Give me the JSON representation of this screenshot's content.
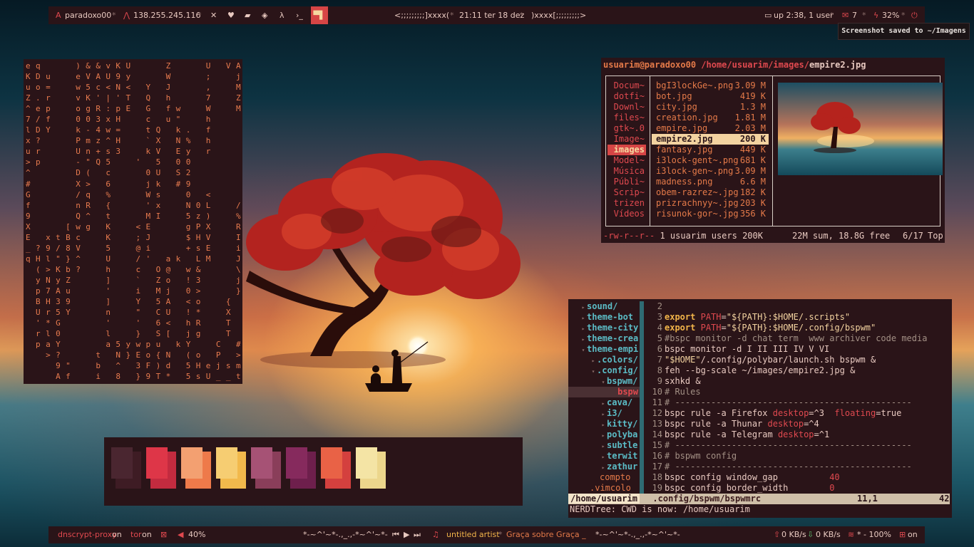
{
  "topbar": {
    "hostname": "paradoxo00",
    "ip": "138.255.245.116",
    "separator": "*",
    "workspace_icons": [
      "x-icon",
      "heart-icon",
      "folder-icon",
      "fox-icon",
      "lambda-icon",
      "terminal-icon"
    ],
    "active_workspace_glyph": "▀▌",
    "deco_left": "<;;;;;;;;;]xxxx(",
    "clock": "21:11 ter 18 dez",
    "deco_right": ")xxxx[;;;;;;;;;>",
    "uptime": "up 2:38, 1 user",
    "mail_count": "7",
    "battery": "32%"
  },
  "notification": "Screenshot saved to ~/Imagens",
  "matrix_lines": [
    "e q       ) & & v K U       Z       U   V A a",
    "K D u     e V A U 9 y       W       ;     j >",
    "u o =     w 5 c < N <   Y   J       ,     M",
    "Z . r     v K ' | ' T   Q   h       7     Z",
    "^ e p     o g R : p E   G   f w     W     M",
    "7 / f     0 0 3 x H     c   u \"     h",
    "l D Y     k - 4 w =     t Q   k .   f",
    "x ?       P m z ^ H     ` X   N %   h",
    "u r       U n + s 3     k V   E y   r",
    "> p       - \" Q 5     '   5   0 0",
    "^         D (   c       0 U   S 2",
    "#         X >   6       j k   # 9",
    "G         / q   %       W s     0   <       y",
    "f         n R   {       ' x     N 0 L     / #",
    "9         Q ^   t       M I     5 z )     % |",
    "X       [ w g   K     < E       g P X     R u %",
    "E   x t B c     K     ; J       $ H V     I l -",
    "_ ? 9 / 8 V     5     @ i       + s E     i * ;",
    "q H l \" } ^     U     / '   a k   L M     J o t",
    "  ( > K b ?     h     c   O @   w &       \\ 0 X",
    "  y N y Z       ]     `   Z o   ! 3       j w ,",
    "  p 7 A u       '     i   M j   0 >       } w .",
    "  B H 3 9       ]     Y   5 A   < o     {   t &",
    "  U r 5 Y       n     \"   C U   ! *     X   <",
    "  ' * G         '     '   6 <   h R     T   (",
    "  r l 0         l     }   S [   j g     T   (",
    "  p a Y         a 5 y w p u   k Y     C   #",
    "    > ?       t   N } E o { N   ( o   P   >",
    "      9 \"     b   ^   3 F ) d   5 H e j s m",
    "      A f     i   8   } 9 T *   5 s U _ _ t"
  ],
  "palette": {
    "colors": [
      "#3e1c24",
      "#c32b3f",
      "#ee7a4a",
      "#f2b94c",
      "#8a3e5a",
      "#6e1f4c",
      "#d4403e",
      "#ecd68c"
    ],
    "shades": [
      "#4a2630",
      "#de3648",
      "#f3a071",
      "#f6cd72",
      "#a65275",
      "#862a5d",
      "#e96246",
      "#f4e4a5"
    ]
  },
  "ranger": {
    "user_host": "usuarim@paradoxo00",
    "dir_path": "/home/usuarim/images/",
    "file_name": "empire2.jpg",
    "parent_dirs": [
      "Docum~",
      "dotfi~",
      "Downl~",
      "files~",
      "gtk~.0",
      "Image~",
      "images",
      "Model~",
      "Música",
      "Públi~",
      "Scrip~",
      "trizen",
      "Vídeos"
    ],
    "files": [
      {
        "name": "bgI3lockGe~.png",
        "size": "3.09 M"
      },
      {
        "name": "bot.jpg",
        "size": "419 K"
      },
      {
        "name": "city.jpg",
        "size": "1.3 M"
      },
      {
        "name": "creation.jpg",
        "size": "1.81 M"
      },
      {
        "name": "empire.jpg",
        "size": "2.03 M"
      },
      {
        "name": "empire2.jpg",
        "size": "200 K"
      },
      {
        "name": "fantasy.jpg",
        "size": "449 K"
      },
      {
        "name": "i3lock-gent~.png",
        "size": "681 K"
      },
      {
        "name": "i3lock-gen~.png",
        "size": "3.09 M"
      },
      {
        "name": "madness.png",
        "size": "6.6 M"
      },
      {
        "name": "obem-razrez~.jpg",
        "size": "182 K"
      },
      {
        "name": "prizrachnyy~.jpg",
        "size": "203 K"
      },
      {
        "name": "risunok-gor~.jpg",
        "size": "356 K"
      }
    ],
    "perms": "-rw-r--r--",
    "meta": "1 usuarim users 200K",
    "summary": "22M sum, 18.8G free",
    "position": "6/17",
    "scroll": "Top"
  },
  "vim": {
    "tree": [
      {
        "name": "sound/",
        "indent": 1,
        "arrow": "▸",
        "type": "dir"
      },
      {
        "name": "theme-bot",
        "indent": 1,
        "arrow": "▸",
        "type": "dir"
      },
      {
        "name": "theme-city",
        "indent": 1,
        "arrow": "▸",
        "type": "dir"
      },
      {
        "name": "theme-crea",
        "indent": 1,
        "arrow": "▸",
        "type": "dir"
      },
      {
        "name": "theme-empi",
        "indent": 1,
        "arrow": "▾",
        "type": "dir"
      },
      {
        "name": ".colors/",
        "indent": 2,
        "arrow": "▸",
        "type": "dir"
      },
      {
        "name": ".config/",
        "indent": 2,
        "arrow": "▾",
        "type": "dir"
      },
      {
        "name": "bspwm/",
        "indent": 3,
        "arrow": "▾",
        "type": "dir"
      },
      {
        "name": "bspw",
        "indent": 4,
        "arrow": "",
        "type": "cur"
      },
      {
        "name": "cava/",
        "indent": 3,
        "arrow": "▸",
        "type": "dir"
      },
      {
        "name": "i3/",
        "indent": 3,
        "arrow": "▸",
        "type": "dir"
      },
      {
        "name": "kitty/",
        "indent": 3,
        "arrow": "▸",
        "type": "dir"
      },
      {
        "name": "polyba",
        "indent": 3,
        "arrow": "▸",
        "type": "dir"
      },
      {
        "name": "subtle",
        "indent": 3,
        "arrow": "▸",
        "type": "dir"
      },
      {
        "name": "terwit",
        "indent": 3,
        "arrow": "▸",
        "type": "dir"
      },
      {
        "name": "zathur",
        "indent": 3,
        "arrow": "▸",
        "type": "dir"
      },
      {
        "name": "compto",
        "indent": 3,
        "arrow": "",
        "type": "file"
      },
      {
        "name": ".vimcolo",
        "indent": 2,
        "arrow": "",
        "type": "file"
      }
    ],
    "code": [
      {
        "n": "2",
        "t": []
      },
      {
        "n": "3",
        "t": [
          [
            "kw",
            "export"
          ],
          [
            "pu",
            " "
          ],
          [
            "sv",
            "PATH"
          ],
          [
            "pu",
            "="
          ],
          [
            "st",
            "\"${PATH}:$HOME/.scripts\""
          ]
        ]
      },
      {
        "n": "4",
        "t": [
          [
            "kw",
            "export"
          ],
          [
            "pu",
            " "
          ],
          [
            "sv",
            "PATH"
          ],
          [
            "pu",
            "="
          ],
          [
            "st",
            "\"${PATH}:$HOME/.config/bspwm\""
          ]
        ]
      },
      {
        "n": "5",
        "t": [
          [
            "cm",
            "#bspc monitor -d chat term  www archiver code media"
          ]
        ]
      },
      {
        "n": "6",
        "t": [
          [
            "pu",
            "bspc monitor -d I II III IV V VI"
          ]
        ]
      },
      {
        "n": "7",
        "t": [
          [
            "st",
            "\"$HOME\""
          ],
          [
            "pu",
            "/.config/polybar/launch.sh bspwm &"
          ]
        ]
      },
      {
        "n": "8",
        "t": [
          [
            "pu",
            "feh --bg-scale ~/images/empire2.jpg &"
          ]
        ]
      },
      {
        "n": "9",
        "t": [
          [
            "pu",
            "sxhkd &"
          ]
        ]
      },
      {
        "n": "10",
        "t": [
          [
            "cm",
            "# Rules"
          ]
        ]
      },
      {
        "n": "11",
        "t": [
          [
            "cm",
            "# ----------------------------------------------"
          ]
        ]
      },
      {
        "n": "12",
        "t": [
          [
            "pu",
            "bspc rule -a Firefox "
          ],
          [
            "sv",
            "desktop"
          ],
          [
            "pu",
            "=^3  "
          ],
          [
            "sv",
            "floating"
          ],
          [
            "pu",
            "=true"
          ]
        ]
      },
      {
        "n": "13",
        "t": [
          [
            "pu",
            "bspc rule -a Thunar "
          ],
          [
            "sv",
            "desktop"
          ],
          [
            "pu",
            "=^4"
          ]
        ]
      },
      {
        "n": "14",
        "t": [
          [
            "pu",
            "bspc rule -a Telegram "
          ],
          [
            "sv",
            "desktop"
          ],
          [
            "pu",
            "=^1"
          ]
        ]
      },
      {
        "n": "15",
        "t": [
          [
            "cm",
            "# ----------------------------------------------"
          ]
        ]
      },
      {
        "n": "16",
        "t": [
          [
            "cm",
            "# bspwm config"
          ]
        ]
      },
      {
        "n": "17",
        "t": [
          [
            "cm",
            "# ----------------------------------------------"
          ]
        ]
      },
      {
        "n": "18",
        "t": [
          [
            "pu",
            "bspc config window_gap          "
          ],
          [
            "sv",
            "40"
          ]
        ]
      },
      {
        "n": "19",
        "t": [
          [
            "pu",
            "bspc config border_width        "
          ],
          [
            "sv",
            "0"
          ]
        ]
      }
    ],
    "status_left": "/home/usuarim",
    "status_file": ".config/bspwm/bspwmrc",
    "status_pos": "11,1",
    "status_pct": "42",
    "cmdline": "NERDTree: CWD is now: /home/usuarim"
  },
  "bottombar": {
    "dnscrypt_label": "dnscrypt-proxy",
    "dnscrypt_state": "on",
    "tor_label": "tor",
    "tor_state": "on",
    "volume": "40%",
    "deco": "*-~^'~*-.,_.,-*~^'~*-",
    "artist": "untitled artist",
    "track": "Graça sobre Graça _",
    "deco2": "*-~^'~*-.,_.,-*~^'~*-",
    "net_up": "0 KB/s",
    "net_down": "0 KB/s",
    "wifi": "* - 100%",
    "vpn_state": "on"
  }
}
